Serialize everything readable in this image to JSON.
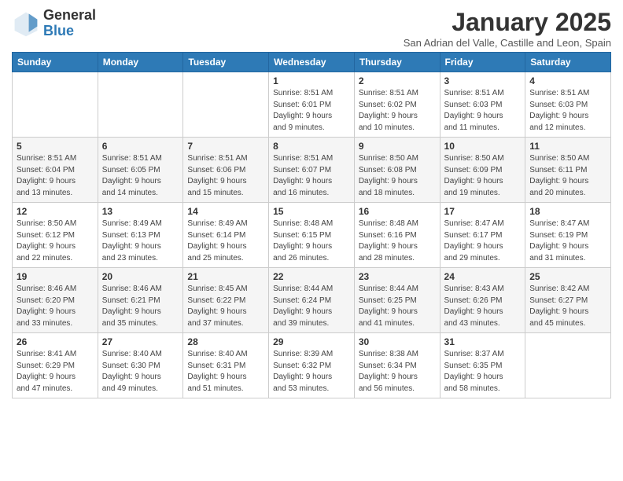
{
  "header": {
    "logo_general": "General",
    "logo_blue": "Blue",
    "month_title": "January 2025",
    "subtitle": "San Adrian del Valle, Castille and Leon, Spain"
  },
  "days_of_week": [
    "Sunday",
    "Monday",
    "Tuesday",
    "Wednesday",
    "Thursday",
    "Friday",
    "Saturday"
  ],
  "weeks": [
    [
      {
        "day": "",
        "info": ""
      },
      {
        "day": "",
        "info": ""
      },
      {
        "day": "",
        "info": ""
      },
      {
        "day": "1",
        "info": "Sunrise: 8:51 AM\nSunset: 6:01 PM\nDaylight: 9 hours\nand 9 minutes."
      },
      {
        "day": "2",
        "info": "Sunrise: 8:51 AM\nSunset: 6:02 PM\nDaylight: 9 hours\nand 10 minutes."
      },
      {
        "day": "3",
        "info": "Sunrise: 8:51 AM\nSunset: 6:03 PM\nDaylight: 9 hours\nand 11 minutes."
      },
      {
        "day": "4",
        "info": "Sunrise: 8:51 AM\nSunset: 6:03 PM\nDaylight: 9 hours\nand 12 minutes."
      }
    ],
    [
      {
        "day": "5",
        "info": "Sunrise: 8:51 AM\nSunset: 6:04 PM\nDaylight: 9 hours\nand 13 minutes."
      },
      {
        "day": "6",
        "info": "Sunrise: 8:51 AM\nSunset: 6:05 PM\nDaylight: 9 hours\nand 14 minutes."
      },
      {
        "day": "7",
        "info": "Sunrise: 8:51 AM\nSunset: 6:06 PM\nDaylight: 9 hours\nand 15 minutes."
      },
      {
        "day": "8",
        "info": "Sunrise: 8:51 AM\nSunset: 6:07 PM\nDaylight: 9 hours\nand 16 minutes."
      },
      {
        "day": "9",
        "info": "Sunrise: 8:50 AM\nSunset: 6:08 PM\nDaylight: 9 hours\nand 18 minutes."
      },
      {
        "day": "10",
        "info": "Sunrise: 8:50 AM\nSunset: 6:09 PM\nDaylight: 9 hours\nand 19 minutes."
      },
      {
        "day": "11",
        "info": "Sunrise: 8:50 AM\nSunset: 6:11 PM\nDaylight: 9 hours\nand 20 minutes."
      }
    ],
    [
      {
        "day": "12",
        "info": "Sunrise: 8:50 AM\nSunset: 6:12 PM\nDaylight: 9 hours\nand 22 minutes."
      },
      {
        "day": "13",
        "info": "Sunrise: 8:49 AM\nSunset: 6:13 PM\nDaylight: 9 hours\nand 23 minutes."
      },
      {
        "day": "14",
        "info": "Sunrise: 8:49 AM\nSunset: 6:14 PM\nDaylight: 9 hours\nand 25 minutes."
      },
      {
        "day": "15",
        "info": "Sunrise: 8:48 AM\nSunset: 6:15 PM\nDaylight: 9 hours\nand 26 minutes."
      },
      {
        "day": "16",
        "info": "Sunrise: 8:48 AM\nSunset: 6:16 PM\nDaylight: 9 hours\nand 28 minutes."
      },
      {
        "day": "17",
        "info": "Sunrise: 8:47 AM\nSunset: 6:17 PM\nDaylight: 9 hours\nand 29 minutes."
      },
      {
        "day": "18",
        "info": "Sunrise: 8:47 AM\nSunset: 6:19 PM\nDaylight: 9 hours\nand 31 minutes."
      }
    ],
    [
      {
        "day": "19",
        "info": "Sunrise: 8:46 AM\nSunset: 6:20 PM\nDaylight: 9 hours\nand 33 minutes."
      },
      {
        "day": "20",
        "info": "Sunrise: 8:46 AM\nSunset: 6:21 PM\nDaylight: 9 hours\nand 35 minutes."
      },
      {
        "day": "21",
        "info": "Sunrise: 8:45 AM\nSunset: 6:22 PM\nDaylight: 9 hours\nand 37 minutes."
      },
      {
        "day": "22",
        "info": "Sunrise: 8:44 AM\nSunset: 6:24 PM\nDaylight: 9 hours\nand 39 minutes."
      },
      {
        "day": "23",
        "info": "Sunrise: 8:44 AM\nSunset: 6:25 PM\nDaylight: 9 hours\nand 41 minutes."
      },
      {
        "day": "24",
        "info": "Sunrise: 8:43 AM\nSunset: 6:26 PM\nDaylight: 9 hours\nand 43 minutes."
      },
      {
        "day": "25",
        "info": "Sunrise: 8:42 AM\nSunset: 6:27 PM\nDaylight: 9 hours\nand 45 minutes."
      }
    ],
    [
      {
        "day": "26",
        "info": "Sunrise: 8:41 AM\nSunset: 6:29 PM\nDaylight: 9 hours\nand 47 minutes."
      },
      {
        "day": "27",
        "info": "Sunrise: 8:40 AM\nSunset: 6:30 PM\nDaylight: 9 hours\nand 49 minutes."
      },
      {
        "day": "28",
        "info": "Sunrise: 8:40 AM\nSunset: 6:31 PM\nDaylight: 9 hours\nand 51 minutes."
      },
      {
        "day": "29",
        "info": "Sunrise: 8:39 AM\nSunset: 6:32 PM\nDaylight: 9 hours\nand 53 minutes."
      },
      {
        "day": "30",
        "info": "Sunrise: 8:38 AM\nSunset: 6:34 PM\nDaylight: 9 hours\nand 56 minutes."
      },
      {
        "day": "31",
        "info": "Sunrise: 8:37 AM\nSunset: 6:35 PM\nDaylight: 9 hours\nand 58 minutes."
      },
      {
        "day": "",
        "info": ""
      }
    ]
  ]
}
